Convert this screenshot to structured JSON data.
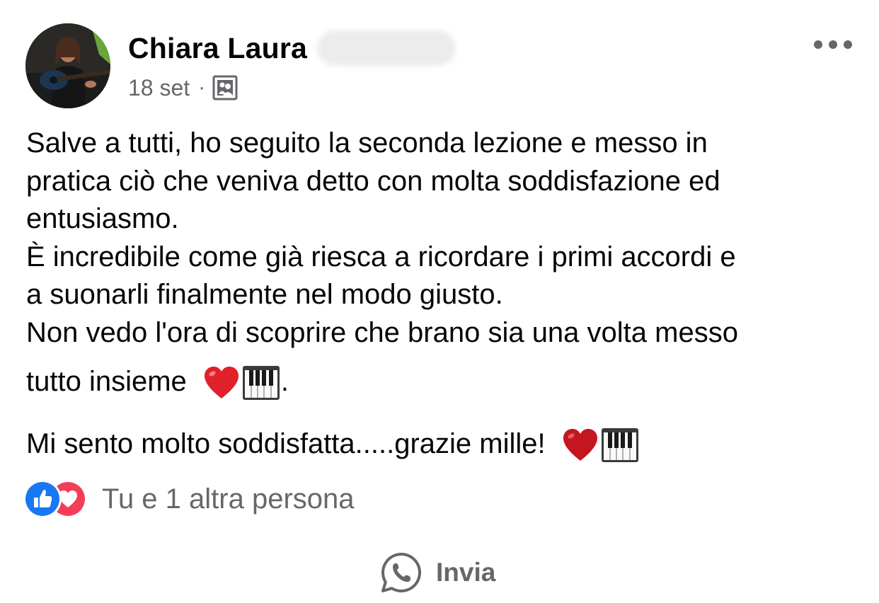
{
  "post": {
    "author_name": "Chiara Laura",
    "date": "18 set",
    "separator": "·",
    "audience_icon": "group-audience-icon",
    "more_icon": "more-options-icon",
    "body_lines": [
      "Salve a tutti, ho seguito la seconda lezione e messo in",
      "pratica ciò che veniva detto con molta soddisfazione ed",
      "entusiasmo.",
      "È incredibile come già riesca a ricordare i primi accordi e",
      "a suonarli finalmente nel modo giusto.",
      "Non vedo l'ora di scoprire che brano sia una volta messo",
      "tutto insieme",
      ".",
      "Mi sento molto soddisfatta.....grazie mille!"
    ]
  },
  "reactions": {
    "icons": [
      "like-icon",
      "love-icon"
    ],
    "text": "Tu e 1 altra persona"
  },
  "share": {
    "icon": "whatsapp-icon",
    "label": "Invia"
  },
  "colors": {
    "text": "#050505",
    "secondary": "#65676b",
    "like_blue": "#1877f2",
    "love_red": "#f33e58"
  }
}
